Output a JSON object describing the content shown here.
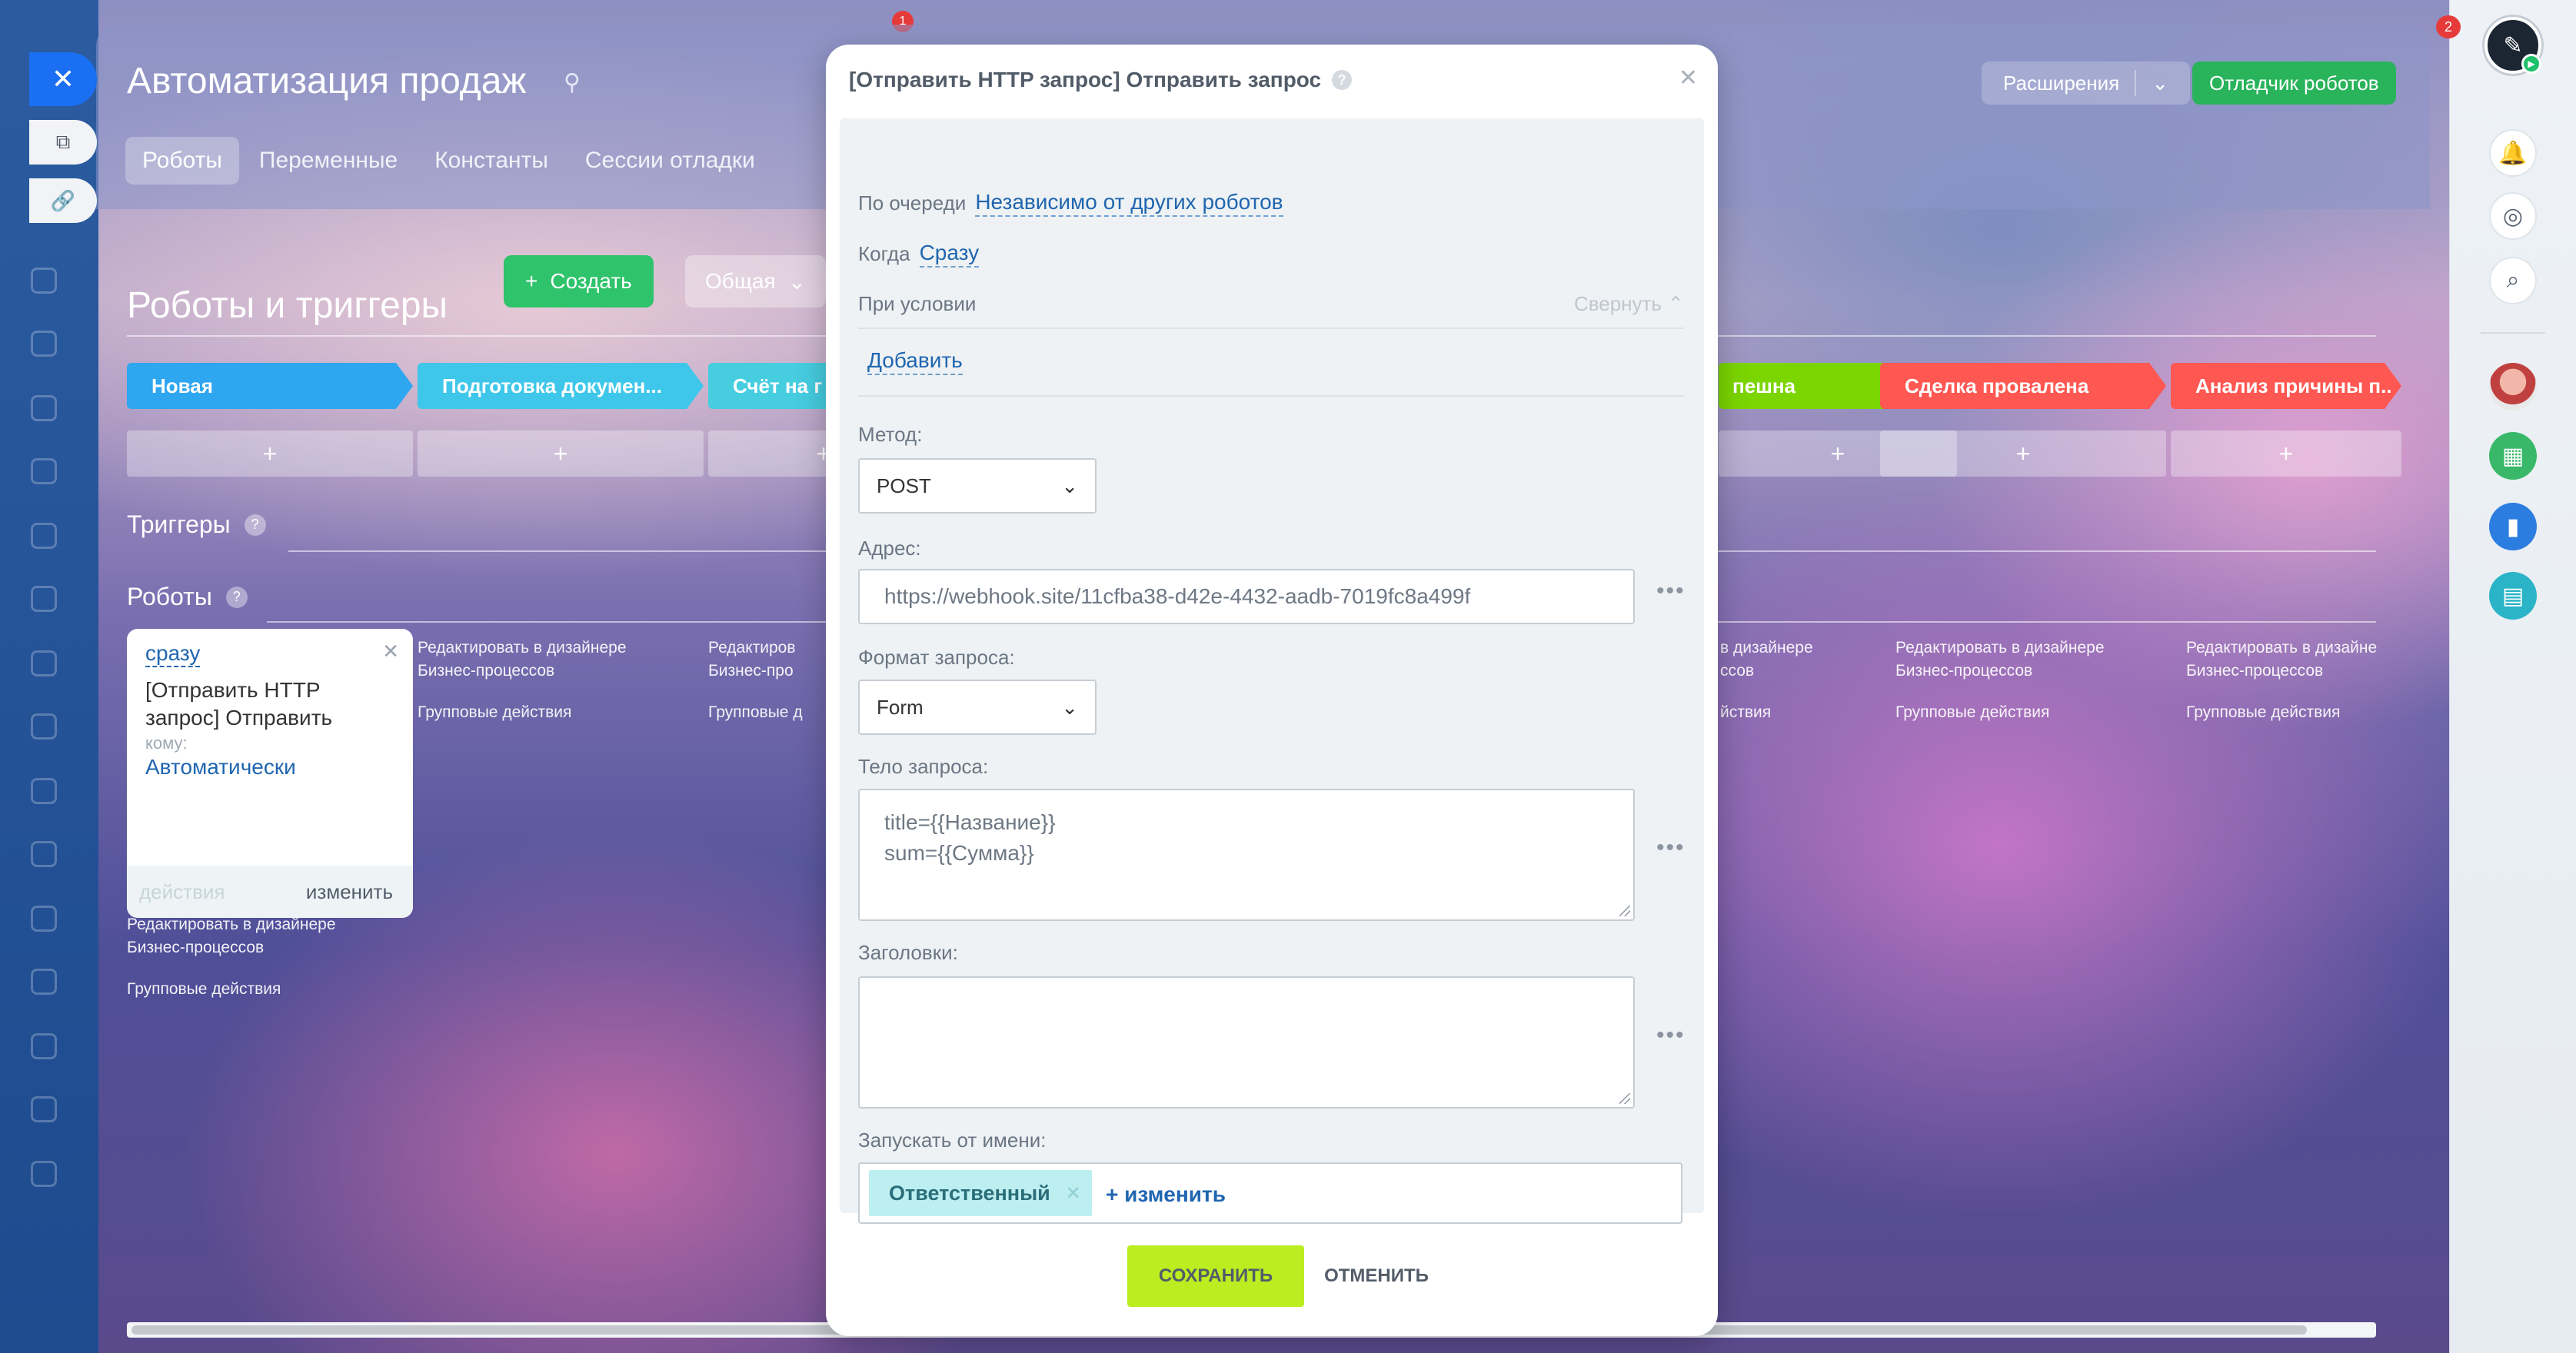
{
  "window": {
    "top_counter": "1",
    "right_counter": "2"
  },
  "slider": {
    "title": "Автоматизация продаж",
    "tabs": [
      {
        "label": "Роботы"
      },
      {
        "label": "Переменные"
      },
      {
        "label": "Константы"
      },
      {
        "label": "Сессии отладки"
      }
    ],
    "extensions_label": "Расширения",
    "debugger_label": "Отладчик роботов",
    "section_title": "Роботы и триггеры",
    "create_label": "Создать",
    "general_label": "Общая",
    "stages": [
      {
        "label": "Новая",
        "color": "#2fa6f0"
      },
      {
        "label": "Подготовка докумен...",
        "color": "#3ec7ea"
      },
      {
        "label": "Счёт на г",
        "color": "#46cde0"
      },
      {
        "label": "пешна",
        "color": "#7bd500"
      },
      {
        "label": "Сделка провалена",
        "color": "#ff5752"
      },
      {
        "label": "Анализ причины п..",
        "color": "#ff5752"
      }
    ],
    "triggers_label": "Триггеры",
    "robots_label": "Роботы",
    "robot_card": {
      "when": "сразу",
      "name": "[Отправить HTTP запрос] Отправить",
      "to_label": "кому:",
      "to_value": "Автоматически",
      "actions_label": "действия",
      "edit_label": "изменить"
    },
    "column_links": {
      "edit_designer": "Редактировать в дизайнере Бизнес-процессов",
      "edit_designer_clipped_a": "Редактиров Бизнес-про",
      "edit_designer_clipped_b": "в дизайнере ссов",
      "edit_designer_clipped_c": "Редактировать в дизайне Бизнес-процессов",
      "group_actions": "Групповые действия",
      "group_actions_clipped_a": "Групповые д",
      "group_actions_clipped_b": "йствия"
    }
  },
  "modal": {
    "title": "[Отправить HTTP запрос] Отправить запрос",
    "queue_label": "По очереди",
    "queue_value": "Независимо от других роботов",
    "when_label": "Когда",
    "when_value": "Сразу",
    "condition_label": "При условии",
    "collapse_label": "Свернуть",
    "add_label": "Добавить",
    "method_label": "Метод:",
    "method_value": "POST",
    "address_label": "Адрес:",
    "address_value": "https://webhook.site/11cfba38-d42e-4432-aadb-7019fc8a499f",
    "format_label": "Формат запроса:",
    "format_value": "Form",
    "body_label": "Тело запроса:",
    "body_line1": "title={{Название}}",
    "body_line2": "sum={{Сумма}}",
    "headers_label": "Заголовки:",
    "headers_value": "",
    "run_as_label": "Запускать от имени:",
    "run_as_tag": "Ответственный",
    "run_as_change": "+ изменить",
    "save_label": "СОХРАНИТЬ",
    "cancel_label": "ОТМЕНИТЬ"
  }
}
